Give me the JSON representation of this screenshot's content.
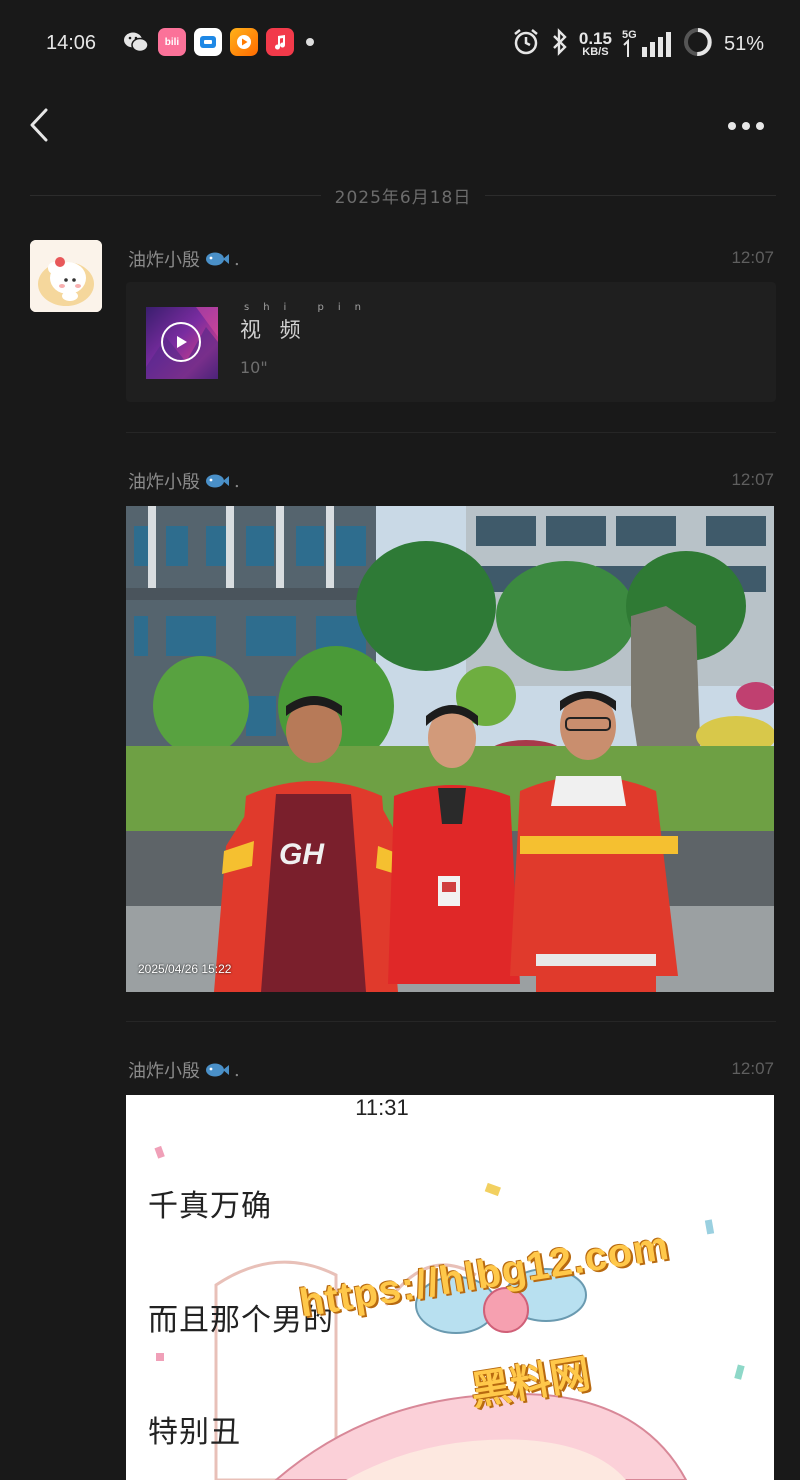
{
  "status_bar": {
    "time": "14:06",
    "apps": [
      "wechat-icon",
      "bilibili-icon",
      "app-blue-icon",
      "video-app-icon",
      "music-icon"
    ],
    "bilibili_label": "bili",
    "net_speed_value": "0.15",
    "net_speed_unit": "KB/S",
    "network": "5G",
    "battery": "51%"
  },
  "nav": {
    "back_icon": "chevron-left-icon",
    "more_icon": "more-horizontal-icon"
  },
  "date_divider": "2025年6月18日",
  "messages": [
    {
      "sender": "油炸小殷",
      "sender_suffix": ".",
      "time": "12:07",
      "type": "video",
      "video_title": "视 频",
      "video_pinyin": "shi pin",
      "video_duration": "10\""
    },
    {
      "sender": "油炸小殷",
      "sender_suffix": ".",
      "time": "12:07",
      "type": "photo",
      "photo_stamp": "2025/04/26 15:22",
      "shirt_text": "GH"
    },
    {
      "sender": "油炸小殷",
      "sender_suffix": ".",
      "time": "12:07",
      "type": "image",
      "image_time": "11:31",
      "image_lines": [
        "千真万确",
        "而且那个男的",
        "特别丑"
      ]
    }
  ],
  "watermark": {
    "url": "https://hlbg12.com",
    "name": "黑料网"
  },
  "colors": {
    "background": "#191919",
    "accent_watermark": "#ffc84a"
  }
}
